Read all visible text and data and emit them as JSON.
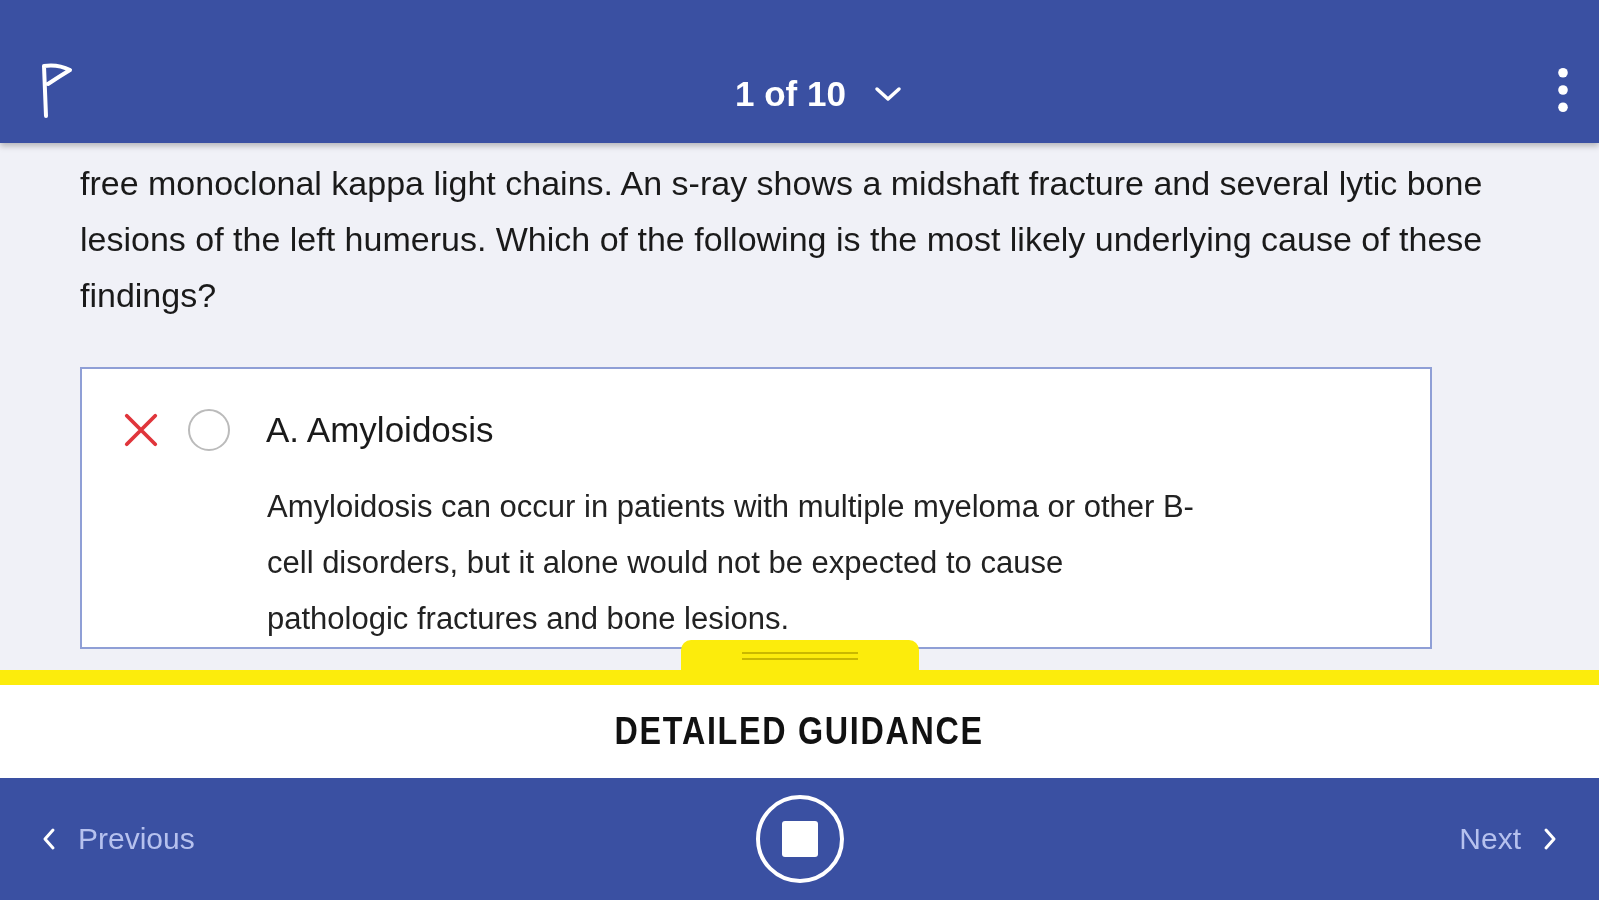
{
  "header": {
    "counter": "1 of 10"
  },
  "question": {
    "text": "free monoclonal kappa light chains. An s-ray shows a midshaft fracture and several lytic bone lesions of the left humerus. Which of the following is the most likely underlying cause of these findings?"
  },
  "options": [
    {
      "label": "A. Amyloidosis",
      "eliminated": true,
      "selected": false,
      "explanation": "Amyloidosis can occur in patients with multiple myeloma or other B-cell disorders, but it alone would not be expected to cause pathologic fractures and bone lesions."
    }
  ],
  "guidance": {
    "title": "DETAILED GUIDANCE"
  },
  "nav": {
    "previous": "Previous",
    "next": "Next"
  }
}
